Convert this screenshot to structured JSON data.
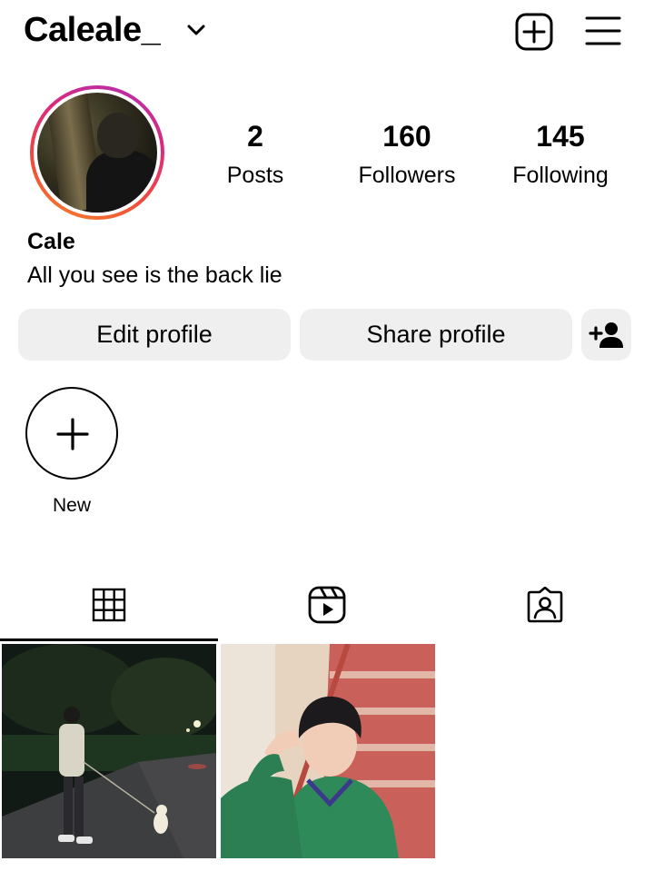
{
  "header": {
    "username": "Caleale_",
    "icons": {
      "account_switcher": "chevron-down-icon",
      "create": "plus-square-icon",
      "menu": "hamburger-menu-icon"
    }
  },
  "profile": {
    "avatar": "profile-photo",
    "stats": [
      {
        "value": "2",
        "label": "Posts"
      },
      {
        "value": "160",
        "label": "Followers"
      },
      {
        "value": "145",
        "label": "Following"
      }
    ],
    "display_name": "Cale",
    "bio": "All you see is the back lie"
  },
  "actions": {
    "edit_label": "Edit profile",
    "share_label": "Share profile",
    "discover_icon": "add-person-icon"
  },
  "highlights": {
    "new_label": "New"
  },
  "tabs": [
    {
      "name": "grid",
      "icon": "grid-icon",
      "active": true
    },
    {
      "name": "reels",
      "icon": "reels-icon",
      "active": false
    },
    {
      "name": "tagged",
      "icon": "tagged-icon",
      "active": false
    }
  ],
  "posts": [
    {
      "description": "night walk with small white dog"
    },
    {
      "description": "boy in green sweater on red stairs"
    }
  ],
  "colors": {
    "button_bg": "#efefef",
    "story_ring_start": "#b02fb5",
    "story_ring_end": "#f58529",
    "text": "#000000"
  }
}
